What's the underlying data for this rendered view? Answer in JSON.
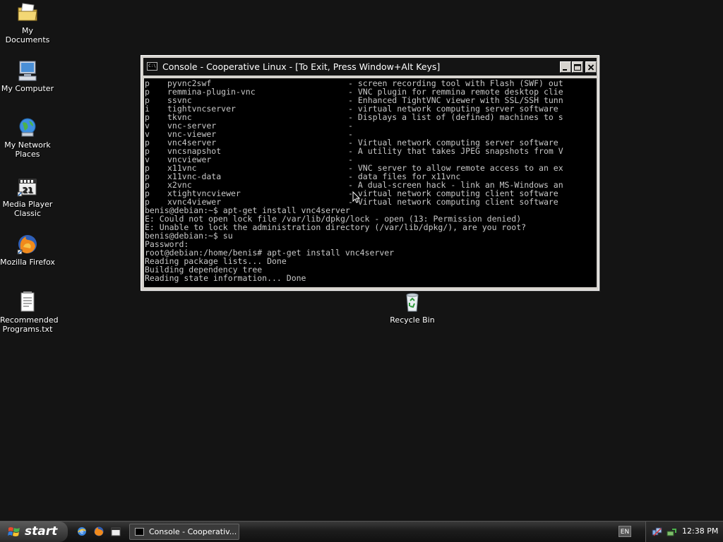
{
  "desktop": {
    "icons": [
      {
        "label": "My Documents"
      },
      {
        "label": "My Computer"
      },
      {
        "label": "My Network Places"
      },
      {
        "label": "Media Player Classic"
      },
      {
        "label": "Mozilla Firefox"
      },
      {
        "label": "Recommended Programs.txt"
      },
      {
        "label": "Recycle Bin"
      }
    ]
  },
  "console": {
    "title": "Console - Cooperative Linux - [To Exit, Press Window+Alt Keys]",
    "icon_text": "C:\\",
    "package_rows": [
      {
        "status": "p",
        "name": "pyvnc2swf",
        "desc": "- screen recording tool with Flash (SWF) out"
      },
      {
        "status": "p",
        "name": "remmina-plugin-vnc",
        "desc": "- VNC plugin for remmina remote desktop clie"
      },
      {
        "status": "p",
        "name": "ssvnc",
        "desc": "- Enhanced TightVNC viewer with SSL/SSH tunn"
      },
      {
        "status": "i",
        "name": "tightvncserver",
        "desc": "- virtual network computing server software"
      },
      {
        "status": "p",
        "name": "tkvnc",
        "desc": "- Displays a list of (defined) machines to s"
      },
      {
        "status": "v",
        "name": "vnc-server",
        "desc": "-"
      },
      {
        "status": "v",
        "name": "vnc-viewer",
        "desc": "-"
      },
      {
        "status": "p",
        "name": "vnc4server",
        "desc": "- Virtual network computing server software"
      },
      {
        "status": "p",
        "name": "vncsnapshot",
        "desc": "- A utility that takes JPEG snapshots from V"
      },
      {
        "status": "v",
        "name": "vncviewer",
        "desc": "-"
      },
      {
        "status": "p",
        "name": "x11vnc",
        "desc": "- VNC server to allow remote access to an ex"
      },
      {
        "status": "p",
        "name": "x11vnc-data",
        "desc": "- data files for x11vnc"
      },
      {
        "status": "p",
        "name": "x2vnc",
        "desc": "- A dual-screen hack - link an MS-Windows an"
      },
      {
        "status": "p",
        "name": "xtightvncviewer",
        "desc": "- virtual network computing client software"
      },
      {
        "status": "p",
        "name": "xvnc4viewer",
        "desc": "- Virtual network computing client software"
      }
    ],
    "output_lines": [
      "benis@debian:~$ apt-get install vnc4server",
      "E: Could not open lock file /var/lib/dpkg/lock - open (13: Permission denied)",
      "E: Unable to lock the administration directory (/var/lib/dpkg/), are you root?",
      "benis@debian:~$ su",
      "Password:",
      "root@debian:/home/benis# apt-get install vnc4server",
      "Reading package lists... Done",
      "Building dependency tree",
      "Reading state information... Done"
    ]
  },
  "taskbar": {
    "start_label": "start",
    "task_button_label": "Console - Cooperativ...",
    "language": "EN",
    "clock": "12:38 PM"
  },
  "colors": {
    "desktop_bg": "#141414",
    "terminal_bg": "#000000",
    "terminal_fg": "#c8c8c8",
    "titlebar_bg": "#141414"
  }
}
